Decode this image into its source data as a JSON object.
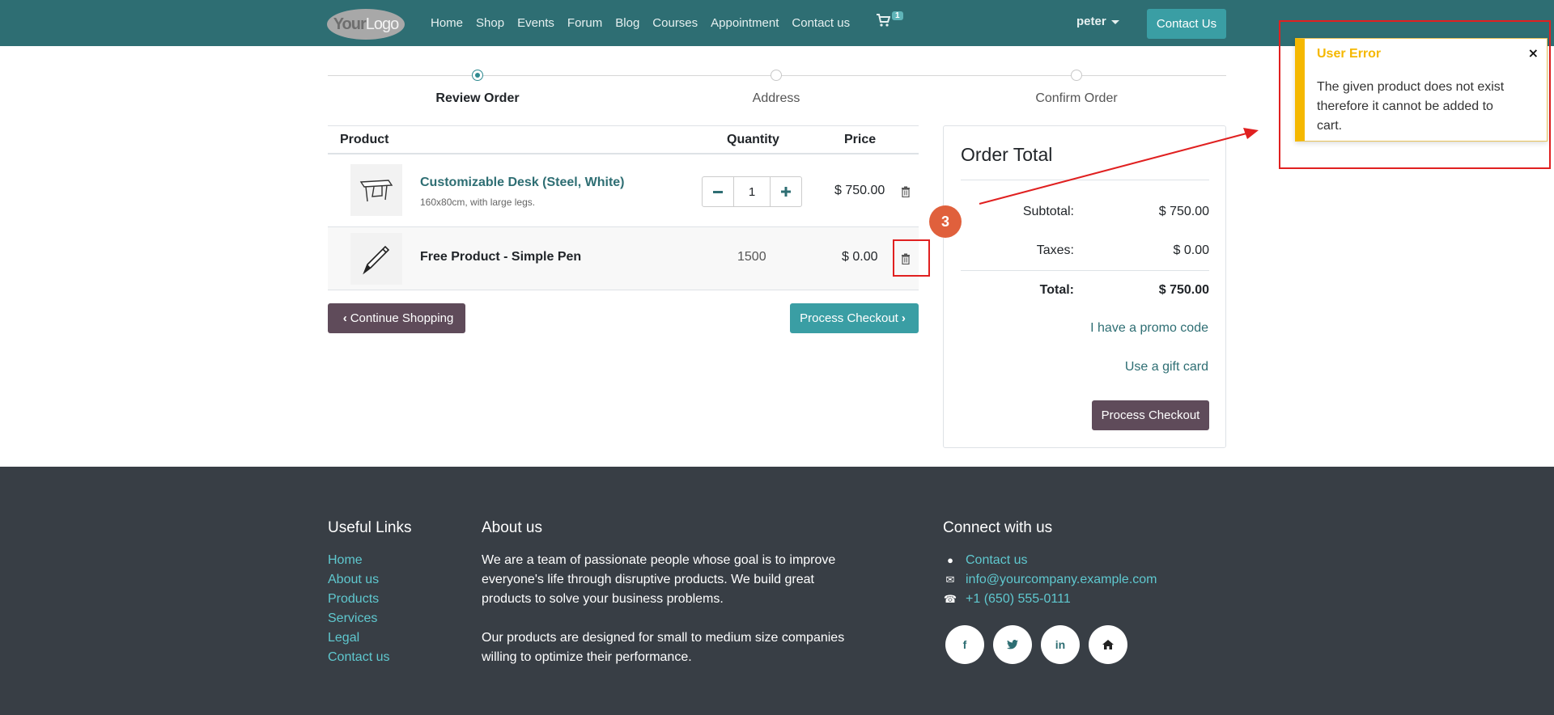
{
  "navbar": {
    "logo_text_a": "Your",
    "logo_text_b": "Logo",
    "links": [
      "Home",
      "Shop",
      "Events",
      "Forum",
      "Blog",
      "Courses",
      "Appointment",
      "Contact us"
    ],
    "cart_count": "1",
    "user": "peter",
    "cta": "Contact Us"
  },
  "steps": [
    {
      "label": "Review Order",
      "active": true
    },
    {
      "label": "Address",
      "active": false
    },
    {
      "label": "Confirm Order",
      "active": false
    }
  ],
  "cart": {
    "headers": {
      "product": "Product",
      "quantity": "Quantity",
      "price": "Price"
    },
    "rows": [
      {
        "name": "Customizable Desk (Steel, White)",
        "description": "160x80cm, with large legs.",
        "quantity": "1",
        "price": "$ 750.00"
      },
      {
        "name": "Free Product - Simple Pen",
        "quantity": "1500",
        "price": "$ 0.00"
      }
    ],
    "continue_label": "Continue Shopping",
    "process_label": "Process Checkout"
  },
  "order_total": {
    "title": "Order Total",
    "subtotal_label": "Subtotal:",
    "subtotal": "$ 750.00",
    "taxes_label": "Taxes:",
    "taxes": "$ 0.00",
    "total_label": "Total:",
    "total": "$ 750.00",
    "promo_link": "I have a promo code",
    "gift_link": "Use a gift card",
    "process_label": "Process Checkout"
  },
  "toast": {
    "title": "User Error",
    "close": "×",
    "message": "The given product does not exist therefore it cannot be added to cart."
  },
  "annotation": {
    "step": "3",
    "color": "#e0603c"
  },
  "footer": {
    "useful_links_title": "Useful Links",
    "useful_links": [
      "Home",
      "About us",
      "Products",
      "Services",
      "Legal",
      "Contact us"
    ],
    "about_title": "About us",
    "about_p1": "We are a team of passionate people whose goal is to improve everyone's life through disruptive products. We build great products to solve your business problems.",
    "about_p2": "Our products are designed for small to medium size companies willing to optimize their performance.",
    "connect_title": "Connect with us",
    "contact_link": "Contact us",
    "email": "info@yourcompany.example.com",
    "phone": "+1 (650) 555-0111",
    "socials": [
      "facebook-icon",
      "twitter-icon",
      "linkedin-icon",
      "home-icon"
    ]
  },
  "colors": {
    "brand": "#2e6e73",
    "accent": "#3a9ea4",
    "secondary": "#5f4b5a",
    "warning": "#f5b800",
    "footer": "#383e45"
  }
}
